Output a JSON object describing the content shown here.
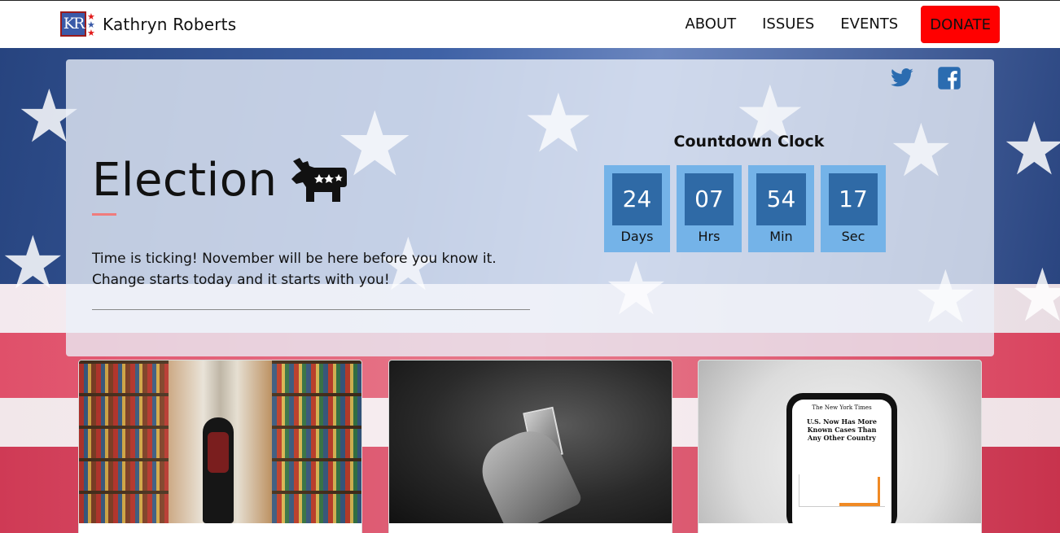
{
  "navbar": {
    "logo_text": "KR",
    "brand_name": "Kathryn Roberts",
    "links": [
      "ABOUT",
      "ISSUES",
      "EVENTS"
    ],
    "donate_label": "DONATE"
  },
  "hero": {
    "title": "Election",
    "text_line1": "Time is ticking! November will be here before you know it.",
    "text_line2": "Change starts today and it starts with you!",
    "countdown": {
      "title": "Countdown Clock",
      "units": [
        {
          "value": "24",
          "label": "Days"
        },
        {
          "value": "07",
          "label": "Hrs"
        },
        {
          "value": "54",
          "label": "Min"
        },
        {
          "value": "17",
          "label": "Sec"
        }
      ]
    }
  },
  "cards": {
    "phone_masthead": "The New York Times",
    "phone_headline": "U.S. Now Has More Known Cases Than Any Other Country"
  },
  "colors": {
    "donate": "#ff0000",
    "countdown_tile": "#74b3e8",
    "countdown_number": "#2f6aa6",
    "twitter": "#2b6cb0",
    "facebook": "#2b6cb0",
    "accent_line": "#f07c7c"
  }
}
